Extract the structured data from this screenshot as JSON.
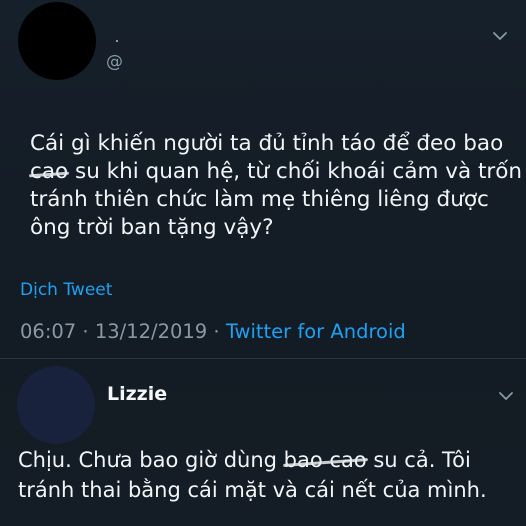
{
  "tweet": {
    "handle_prefix": "@",
    "text_lines": [
      "Cái gì khiến người ta đủ tỉnh táo để đeo bao",
      "su khi quan hệ, từ chối khoái cảm và trốn",
      "tránh thiên chức làm mẹ thiêng liêng được",
      "ông trời ban tặng vậy?"
    ],
    "scribbled_word": "cao",
    "translate_label": "Dịch Tweet",
    "time": "06:07",
    "separator": "·",
    "date": "13/12/2019",
    "source": "Twitter for Android"
  },
  "reply": {
    "name": "Lizzie",
    "line1_before": "Chịu. Chưa bao giờ dùng",
    "line1_scribbled": "bao cao",
    "line1_after": "su cả. Tôi",
    "line2": "tránh thai bằng cái mặt và cái nết của mình."
  },
  "colors": {
    "background": "#141d26",
    "link": "#1da1f2",
    "muted": "#8899a6",
    "text": "#f2f5f7"
  },
  "icons": {
    "main_menu": "chevron-down-icon",
    "reply_menu": "chevron-down-icon"
  }
}
